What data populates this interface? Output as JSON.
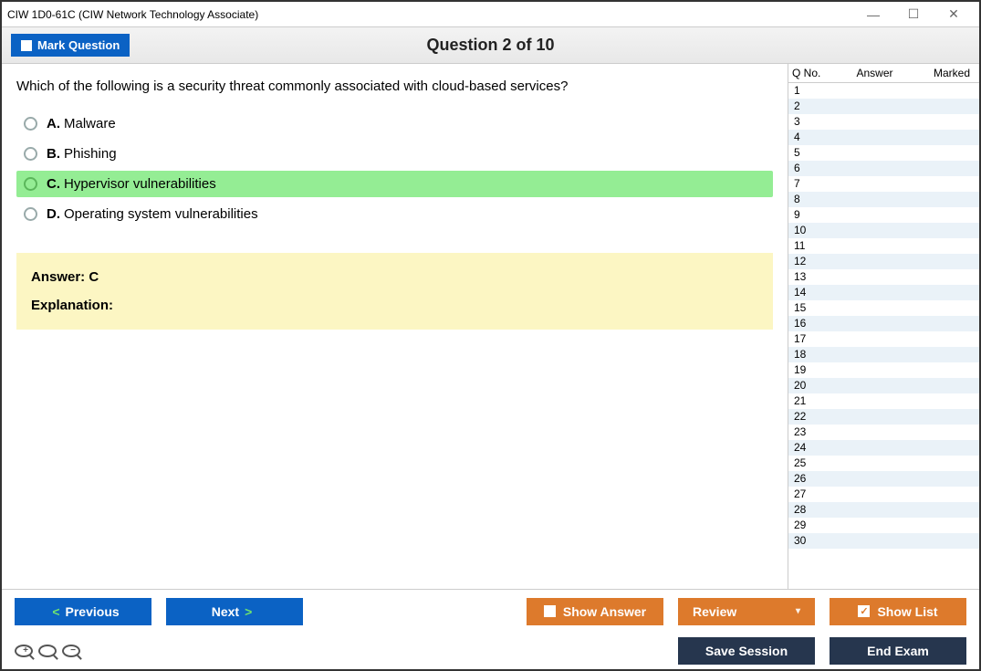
{
  "window": {
    "title": "CIW 1D0-61C (CIW Network Technology Associate)"
  },
  "header": {
    "mark_label": "Mark Question",
    "question_header": "Question 2 of 10"
  },
  "question": {
    "text": "Which of the following is a security threat commonly associated with cloud-based services?",
    "choices": [
      {
        "letter": "A.",
        "text": "Malware",
        "correct": false
      },
      {
        "letter": "B.",
        "text": "Phishing",
        "correct": false
      },
      {
        "letter": "C.",
        "text": "Hypervisor vulnerabilities",
        "correct": true
      },
      {
        "letter": "D.",
        "text": "Operating system vulnerabilities",
        "correct": false
      }
    ],
    "answer_label": "Answer: C",
    "explanation_label": "Explanation:",
    "explanation_text": ""
  },
  "side": {
    "headers": {
      "qno": "Q No.",
      "answer": "Answer",
      "marked": "Marked"
    },
    "rows": [
      1,
      2,
      3,
      4,
      5,
      6,
      7,
      8,
      9,
      10,
      11,
      12,
      13,
      14,
      15,
      16,
      17,
      18,
      19,
      20,
      21,
      22,
      23,
      24,
      25,
      26,
      27,
      28,
      29,
      30
    ]
  },
  "footer": {
    "previous": "Previous",
    "next": "Next",
    "show_answer": "Show Answer",
    "review": "Review",
    "show_list": "Show List",
    "save_session": "Save Session",
    "end_exam": "End Exam"
  }
}
